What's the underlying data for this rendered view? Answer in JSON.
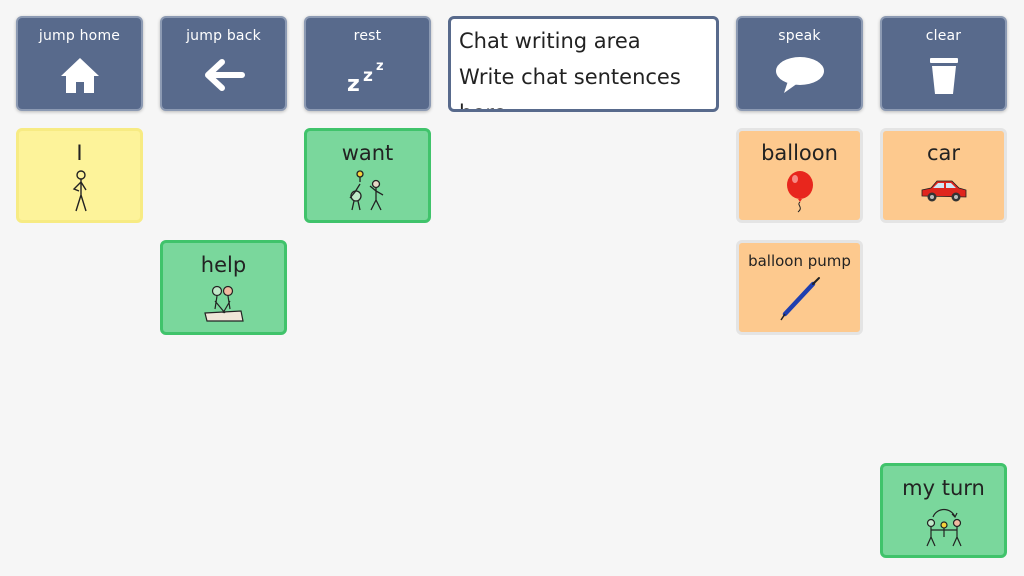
{
  "toolbar": {
    "jump_home": {
      "label": "jump home",
      "icon": "home-icon"
    },
    "jump_back": {
      "label": "jump back",
      "icon": "arrow-left-icon"
    },
    "rest": {
      "label": "rest",
      "icon": "sleep-zzz-icon"
    },
    "speak": {
      "label": "speak",
      "icon": "speech-bubble-icon"
    },
    "clear": {
      "label": "clear",
      "icon": "trash-icon"
    }
  },
  "chat_area": {
    "lines": [
      "Chat writing area",
      "Write chat sentences",
      "here"
    ]
  },
  "symbols": {
    "i": {
      "label": "I",
      "icon": "person-pointing-self-icon"
    },
    "want": {
      "label": "want",
      "icon": "people-want-icon"
    },
    "balloon": {
      "label": "balloon",
      "icon": "red-balloon-icon"
    },
    "car": {
      "label": "car",
      "icon": "red-car-icon"
    },
    "help": {
      "label": "help",
      "icon": "people-helping-icon"
    },
    "balloon_pump": {
      "label": "balloon pump",
      "icon": "balloon-pump-icon"
    },
    "my_turn": {
      "label": "my turn",
      "icon": "turn-taking-icon"
    }
  },
  "colors": {
    "nav_bg": "#586a8c",
    "yellow": "#fdf39a",
    "green": "#7ad79c",
    "orange": "#fdc98e"
  }
}
